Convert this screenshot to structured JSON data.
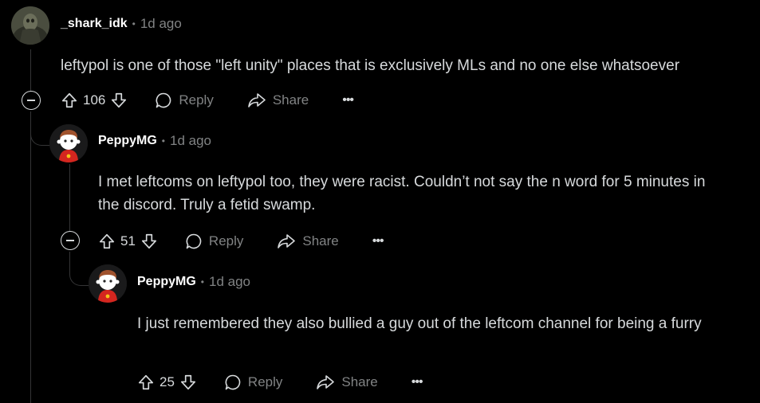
{
  "colors": {
    "background": "#000000",
    "text": "#d7dadc",
    "muted": "#818384",
    "thread_line": "#343536"
  },
  "comments": [
    {
      "username": "_shark_idk",
      "time": "1d ago",
      "body": "leftypol is one of those \"left unity\" places that is exclusively MLs and no one else whatsoever",
      "votes": "106",
      "reply_label": "Reply",
      "share_label": "Share",
      "more_label": "•••"
    },
    {
      "username": "PeppyMG",
      "time": "1d ago",
      "body": "I met leftcoms on leftypol too, they were racist. Couldn’t not say the n word for 5 minutes in the discord. Truly a fetid swamp.",
      "votes": "51",
      "reply_label": "Reply",
      "share_label": "Share",
      "more_label": "•••"
    },
    {
      "username": "PeppyMG",
      "time": "1d ago",
      "body": "I just remembered they also bullied a guy out of the leftcom channel for being a furry",
      "votes": "25",
      "reply_label": "Reply",
      "share_label": "Share",
      "more_label": "•••"
    }
  ],
  "separator": "•",
  "icons": {
    "upvote": "arrow-up-icon",
    "downvote": "arrow-down-icon",
    "reply": "speech-bubble-icon",
    "share": "share-arrow-icon",
    "collapse": "minus-circle-icon"
  }
}
